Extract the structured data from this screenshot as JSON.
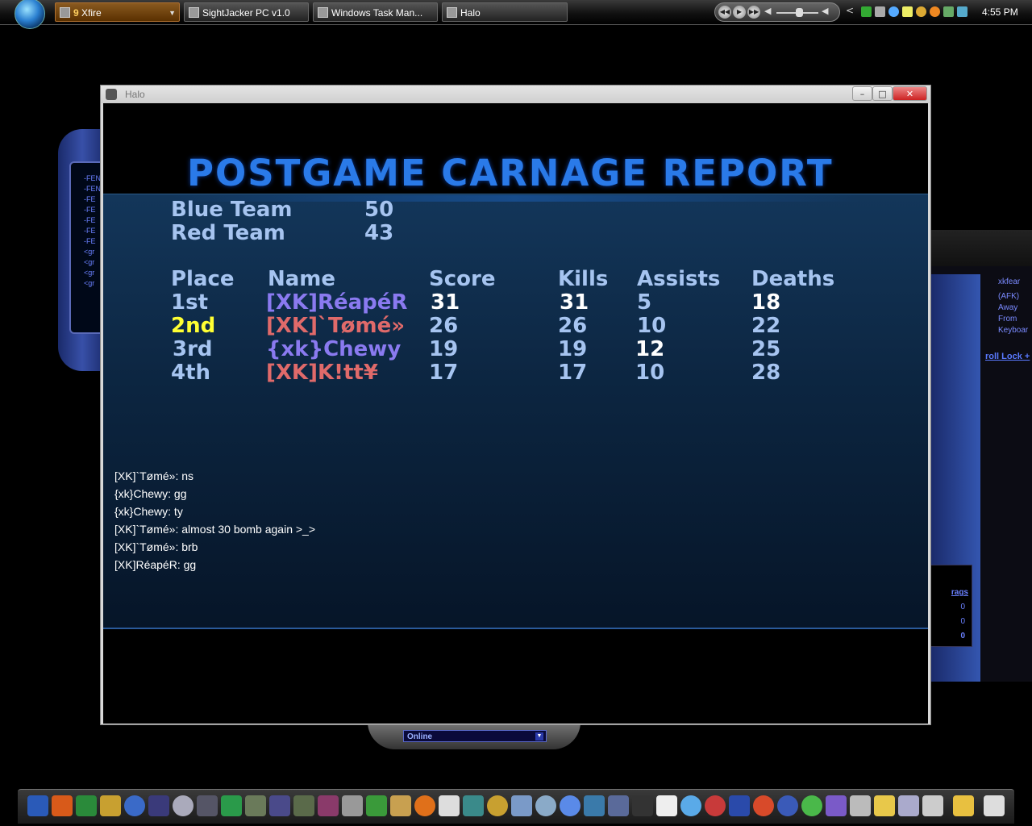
{
  "taskbar": {
    "xfire_count": "9",
    "xfire_label": "Xfire",
    "buttons": [
      "SightJacker PC v1.0",
      "Windows Task Man...",
      "Halo"
    ],
    "clock": "4:55 PM"
  },
  "halo_window": {
    "title": "Halo",
    "minimize_label": "–",
    "maximize_label": "□",
    "close_label": "✕"
  },
  "report": {
    "title": "POSTGAME CARNAGE REPORT",
    "teams": [
      {
        "name": "Blue Team",
        "score": "50"
      },
      {
        "name": "Red Team",
        "score": "43"
      }
    ],
    "headers": {
      "place": "Place",
      "name": "Name",
      "score": "Score",
      "kills": "Kills",
      "assists": "Assists",
      "deaths": "Deaths"
    },
    "rows": [
      {
        "place": "1st",
        "name": "[XK]RéapéR",
        "score": "31",
        "kills": "31",
        "assists": "5",
        "deaths": "18"
      },
      {
        "place": "2nd",
        "name": "[XK]`Tømé»",
        "score": "26",
        "kills": "26",
        "assists": "10",
        "deaths": "22"
      },
      {
        "place": "3rd",
        "name": "{xk}Chewy",
        "score": "19",
        "kills": "19",
        "assists": "12",
        "deaths": "25"
      },
      {
        "place": "4th",
        "name": "[XK]K!tt¥",
        "score": "17",
        "kills": "17",
        "assists": "10",
        "deaths": "28"
      }
    ]
  },
  "chat": [
    "[XK]`Tømé»: ns",
    "{xk}Chewy: gg",
    "{xk}Chewy: ty",
    "[XK]`Tømé»: almost 30 bomb again >_>",
    "[XK]`Tømé»: brb",
    "[XK]RéapéR: gg"
  ],
  "xfire_bg": {
    "status_label": "Online",
    "friend_name": "xkfear",
    "friend_status": [
      "(AFK)",
      "Away",
      "From",
      "Keyboar"
    ],
    "scroll_lock": "roll Lock +",
    "frags_header": "rags",
    "frags": [
      "0",
      "0",
      "0"
    ],
    "left_list": [
      "-FEN",
      "-FEN",
      "-FE",
      "-FE",
      "-FE",
      "-FE",
      "-FE",
      "<gr",
      "<gr",
      "<gr",
      "<gr"
    ]
  }
}
